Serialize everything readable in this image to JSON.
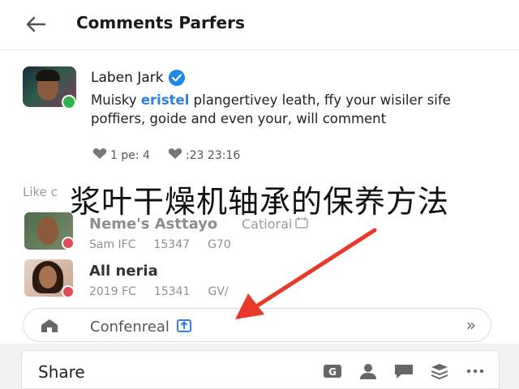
{
  "header": {
    "title": "Comments Parfers"
  },
  "comment": {
    "author": "Laben Jark",
    "text_before": "Muisky",
    "link": "eristel",
    "text_after": "plangertivey leath, ffy your wisiler sife poffiers, goide and even your, will comment",
    "stat_likes": "1 pe: 4",
    "stat_time": ":23 23:16"
  },
  "like_section": {
    "label": "Like c"
  },
  "overlay_caption": "浆叶干燥机轴承的保养方法",
  "rows": [
    {
      "name": "Neme's Asttayo",
      "sub": "Catiorai",
      "meta": [
        "Sam IFC",
        "15347",
        "G70"
      ]
    },
    {
      "name": "All neria",
      "meta": [
        "2019 FC",
        "15341",
        "GV/"
      ]
    }
  ],
  "input": {
    "label": "Confenreal",
    "chevron": "»"
  },
  "share": {
    "label": "Share"
  },
  "colors": {
    "accent": "#2f7ee0",
    "verified": "#1e88e5",
    "arrow": "#e8392b",
    "online": "#2fb24c",
    "badge_red": "#e14a58"
  },
  "icons": [
    "back-arrow-icon",
    "verified-icon",
    "heart-icon",
    "home-icon",
    "upload-icon",
    "chevron-right-icon",
    "g-icon",
    "person-icon",
    "chat-icon",
    "layers-icon",
    "more-icon"
  ]
}
